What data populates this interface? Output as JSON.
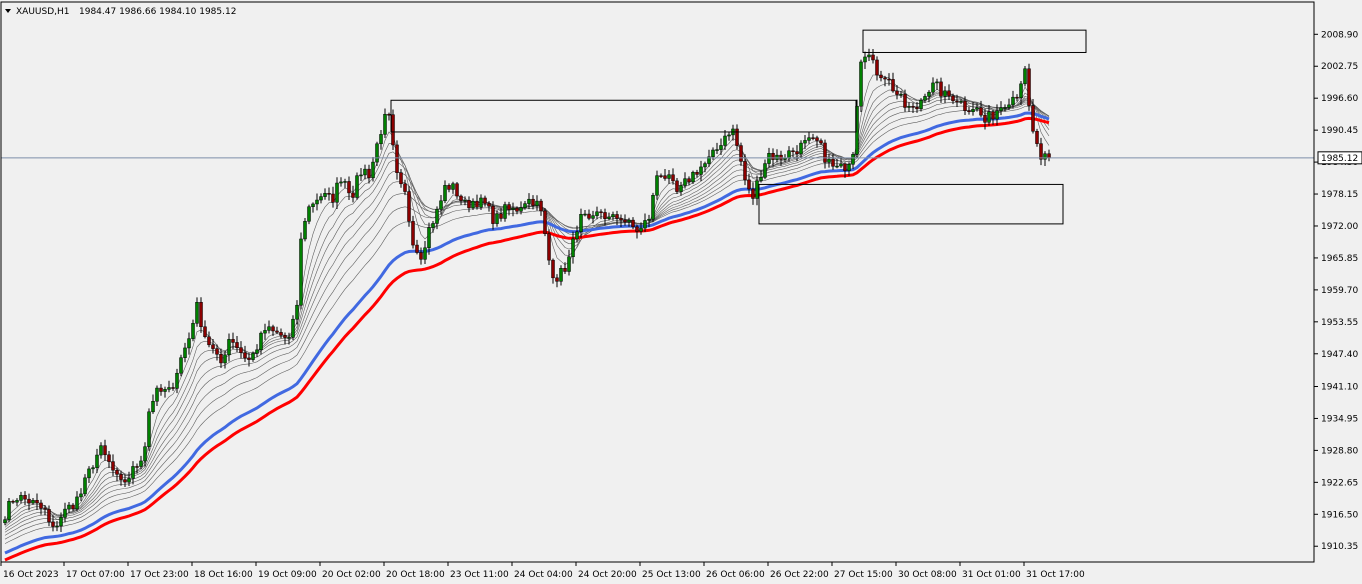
{
  "chart_data": {
    "type": "candlestick",
    "symbol_label": "XAUUSD,H1",
    "ohlc_label": "1984.47 1986.66 1984.10 1985.12",
    "current_price": 1985.12,
    "current_price_label": "1985.12",
    "ylim": [
      1907.7,
      2013.0
    ],
    "y_ticks": [
      "2008.90",
      "2002.75",
      "1996.60",
      "1990.45",
      "1984.30",
      "1978.15",
      "1972.00",
      "1965.85",
      "1959.70",
      "1953.55",
      "1947.40",
      "1941.10",
      "1934.95",
      "1928.80",
      "1922.65",
      "1916.50",
      "1910.35"
    ],
    "x_ticks": [
      "16 Oct 2023",
      "17 Oct 07:00",
      "17 Oct 23:00",
      "18 Oct 16:00",
      "19 Oct 09:00",
      "20 Oct 02:00",
      "20 Oct 18:00",
      "23 Oct 11:00",
      "24 Oct 04:00",
      "24 Oct 20:00",
      "25 Oct 13:00",
      "26 Oct 06:00",
      "26 Oct 22:00",
      "27 Oct 15:00",
      "30 Oct 08:00",
      "31 Oct 01:00",
      "31 Oct 17:00"
    ],
    "series_keypoints": [
      [
        0,
        1915
      ],
      [
        15,
        1920
      ],
      [
        30,
        1919
      ],
      [
        45,
        1917
      ],
      [
        52,
        1913
      ],
      [
        60,
        1916
      ],
      [
        70,
        1918
      ],
      [
        80,
        1920
      ],
      [
        92,
        1926
      ],
      [
        100,
        1929
      ],
      [
        110,
        1926
      ],
      [
        120,
        1922
      ],
      [
        130,
        1924
      ],
      [
        140,
        1927
      ],
      [
        145,
        1930
      ],
      [
        150,
        1938
      ],
      [
        158,
        1940
      ],
      [
        170,
        1940
      ],
      [
        180,
        1946
      ],
      [
        190,
        1951
      ],
      [
        196,
        1957
      ],
      [
        205,
        1951
      ],
      [
        213,
        1948
      ],
      [
        220,
        1945
      ],
      [
        230,
        1951
      ],
      [
        240,
        1948
      ],
      [
        250,
        1946
      ],
      [
        265,
        1952
      ],
      [
        280,
        1951
      ],
      [
        290,
        1950
      ],
      [
        297,
        1957
      ],
      [
        302,
        1972
      ],
      [
        310,
        1976
      ],
      [
        320,
        1978
      ],
      [
        332,
        1977
      ],
      [
        342,
        1982
      ],
      [
        352,
        1978
      ],
      [
        362,
        1983
      ],
      [
        370,
        1982
      ],
      [
        380,
        1990
      ],
      [
        388,
        1994
      ],
      [
        392,
        1988
      ],
      [
        398,
        1980
      ],
      [
        405,
        1978
      ],
      [
        412,
        1970
      ],
      [
        420,
        1966
      ],
      [
        430,
        1972
      ],
      [
        438,
        1975
      ],
      [
        446,
        1980
      ],
      [
        455,
        1979
      ],
      [
        465,
        1976
      ],
      [
        475,
        1977
      ],
      [
        485,
        1976
      ],
      [
        495,
        1973
      ],
      [
        505,
        1975
      ],
      [
        515,
        1975
      ],
      [
        525,
        1977
      ],
      [
        535,
        1977
      ],
      [
        542,
        1974
      ],
      [
        548,
        1966
      ],
      [
        555,
        1962
      ],
      [
        562,
        1963
      ],
      [
        570,
        1966
      ],
      [
        577,
        1972
      ],
      [
        583,
        1974
      ],
      [
        590,
        1972
      ],
      [
        600,
        1975
      ],
      [
        610,
        1973
      ],
      [
        620,
        1974
      ],
      [
        630,
        1972
      ],
      [
        640,
        1971
      ],
      [
        650,
        1974
      ],
      [
        658,
        1983
      ],
      [
        668,
        1981
      ],
      [
        678,
        1978
      ],
      [
        688,
        1981
      ],
      [
        698,
        1983
      ],
      [
        706,
        1984
      ],
      [
        715,
        1986
      ],
      [
        723,
        1989
      ],
      [
        732,
        1991
      ],
      [
        739,
        1986
      ],
      [
        746,
        1980
      ],
      [
        752,
        1977
      ],
      [
        760,
        1982
      ],
      [
        768,
        1986
      ],
      [
        778,
        1985
      ],
      [
        788,
        1986
      ],
      [
        798,
        1987
      ],
      [
        808,
        1988
      ],
      [
        818,
        1988
      ],
      [
        826,
        1985
      ],
      [
        834,
        1983
      ],
      [
        842,
        1983
      ],
      [
        850,
        1985
      ],
      [
        855,
        1988
      ],
      [
        859,
        2004
      ],
      [
        866,
        2006
      ],
      [
        875,
        2002
      ],
      [
        885,
        2001
      ],
      [
        895,
        1998
      ],
      [
        905,
        1995
      ],
      [
        915,
        1994
      ],
      [
        925,
        1998
      ],
      [
        935,
        1999
      ],
      [
        945,
        1997
      ],
      [
        955,
        1997
      ],
      [
        965,
        1995
      ],
      [
        975,
        1995
      ],
      [
        985,
        1992
      ],
      [
        995,
        1994
      ],
      [
        1005,
        1996
      ],
      [
        1013,
        1997
      ],
      [
        1019,
        1998
      ],
      [
        1024,
        2003
      ],
      [
        1028,
        1996
      ],
      [
        1032,
        1990
      ],
      [
        1037,
        1988
      ],
      [
        1041,
        1984
      ],
      [
        1046,
        1985
      ]
    ],
    "ma_periods": [
      5,
      8,
      11,
      14,
      18,
      22,
      27,
      33,
      40
    ],
    "blue_ma_period": 55,
    "red_ma_period": 66,
    "boxes": [
      {
        "x0": 391,
        "x1": 856,
        "y0": 1996.2,
        "y1": 1990.1
      },
      {
        "x0": 863,
        "x1": 1086,
        "y0": 2009.7,
        "y1": 2005.4
      },
      {
        "x0": 759,
        "x1": 1063,
        "y0": 1980.0,
        "y1": 1972.4
      }
    ],
    "colors": {
      "background": "#f0f0f0",
      "bull_body": "#008000",
      "bear_body": "#8b0000",
      "wick": "#000000",
      "ma_thin": "#606060",
      "ma_blue": "#4169e1",
      "ma_red": "#ff0000",
      "price_line": "#7e8ea9"
    }
  }
}
